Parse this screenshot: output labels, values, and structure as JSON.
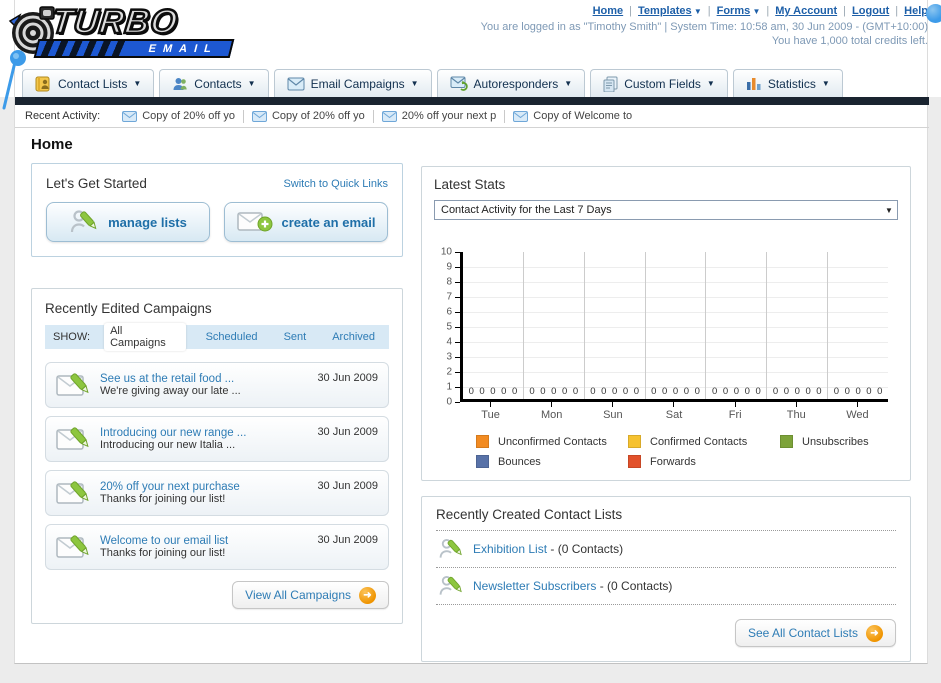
{
  "header": {
    "logo_title": "TURBO",
    "logo_subtitle": "EMAIL",
    "nav": [
      {
        "label": "Home",
        "dropdown": false
      },
      {
        "label": "Templates",
        "dropdown": true
      },
      {
        "label": "Forms",
        "dropdown": true
      },
      {
        "label": "My Account",
        "dropdown": false
      },
      {
        "label": "Logout",
        "dropdown": false
      },
      {
        "label": "Help",
        "dropdown": false
      }
    ],
    "login_line": "You are logged in as \"Timothy Smith\" | System Time: 10:58 am, 30 Jun 2009 - (GMT+10:00)",
    "credits_line": "You have 1,000 total credits left."
  },
  "tabs": [
    {
      "label": "Contact Lists",
      "icon": "contact-lists-icon"
    },
    {
      "label": "Contacts",
      "icon": "contacts-icon"
    },
    {
      "label": "Email Campaigns",
      "icon": "email-campaigns-icon"
    },
    {
      "label": "Autoresponders",
      "icon": "autoresponders-icon"
    },
    {
      "label": "Custom Fields",
      "icon": "custom-fields-icon"
    },
    {
      "label": "Statistics",
      "icon": "statistics-icon"
    }
  ],
  "recent_activity": {
    "label": "Recent Activity:",
    "items": [
      "Copy of 20% off yo",
      "Copy of 20% off yo",
      "20% off your next p",
      "Copy of Welcome to"
    ]
  },
  "page_title": "Home",
  "get_started": {
    "title": "Let's Get Started",
    "switch_link": "Switch to Quick Links",
    "buttons": [
      {
        "label": "manage lists",
        "icon": "list-pencil-icon"
      },
      {
        "label": "create an email",
        "icon": "envelope-plus-icon"
      }
    ]
  },
  "campaigns": {
    "title": "Recently Edited Campaigns",
    "show_label": "SHOW:",
    "filters": [
      {
        "label": "All Campaigns",
        "active": true
      },
      {
        "label": "Scheduled",
        "active": false
      },
      {
        "label": "Sent",
        "active": false
      },
      {
        "label": "Archived",
        "active": false
      }
    ],
    "items": [
      {
        "title": "See us at the retail food ...",
        "subtitle": "We're giving away our late ...",
        "date": "30 Jun 2009"
      },
      {
        "title": "Introducing our new range ...",
        "subtitle": "Introducing our new Italia ...",
        "date": "30 Jun 2009"
      },
      {
        "title": "20% off your next purchase",
        "subtitle": "Thanks for joining our list!",
        "date": "30 Jun 2009"
      },
      {
        "title": "Welcome to our email list",
        "subtitle": "Thanks for joining our list!",
        "date": "30 Jun 2009"
      }
    ],
    "view_all_label": "View All Campaigns"
  },
  "stats": {
    "title": "Latest Stats",
    "dropdown_value": "Contact Activity for the Last 7 Days",
    "chart_data": {
      "type": "bar",
      "categories": [
        "Tue",
        "Mon",
        "Sun",
        "Sat",
        "Fri",
        "Thu",
        "Wed"
      ],
      "series": [
        {
          "name": "Unconfirmed Contacts",
          "color": "#F28B22",
          "values": [
            0,
            0,
            0,
            0,
            0,
            0,
            0
          ]
        },
        {
          "name": "Confirmed Contacts",
          "color": "#F6C230",
          "values": [
            0,
            0,
            0,
            0,
            0,
            0,
            0
          ]
        },
        {
          "name": "Unsubscribes",
          "color": "#7DA33A",
          "values": [
            0,
            0,
            0,
            0,
            0,
            0,
            0
          ]
        },
        {
          "name": "Bounces",
          "color": "#5872A8",
          "values": [
            0,
            0,
            0,
            0,
            0,
            0,
            0
          ]
        },
        {
          "name": "Forwards",
          "color": "#E2512B",
          "values": [
            0,
            0,
            0,
            0,
            0,
            0,
            0
          ]
        }
      ],
      "ylim": [
        0,
        10
      ],
      "yticks": [
        0,
        1,
        2,
        3,
        4,
        5,
        6,
        7,
        8,
        9,
        10
      ],
      "grid": true,
      "legend_position": "bottom",
      "value_label": "0"
    }
  },
  "contact_lists": {
    "title": "Recently Created Contact Lists",
    "items": [
      {
        "name": "Exhibition List",
        "suffix": " - (0 Contacts)"
      },
      {
        "name": "Newsletter Subscribers",
        "suffix": " - (0 Contacts)"
      }
    ],
    "see_all_label": "See All Contact Lists"
  }
}
